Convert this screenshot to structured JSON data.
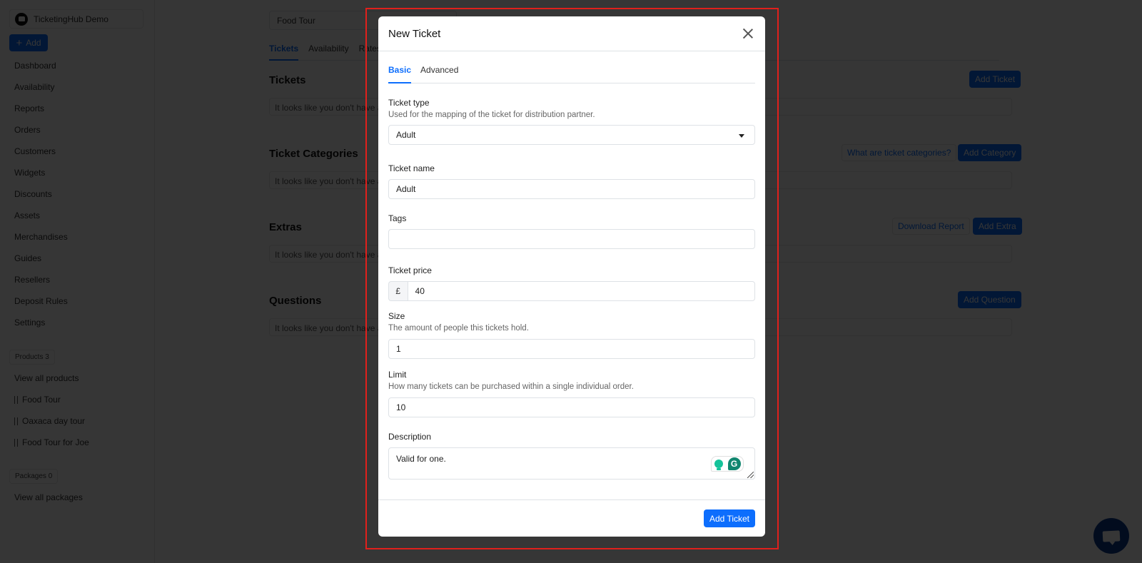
{
  "sidebar": {
    "org_name": "TicketingHub Demo",
    "add_label": "Add",
    "nav": [
      "Dashboard",
      "Availability",
      "Reports",
      "Orders",
      "Customers",
      "Widgets",
      "Discounts",
      "Assets",
      "Merchandises",
      "Guides",
      "Resellers",
      "Deposit Rules",
      "Settings"
    ],
    "products_badge": "Products 3",
    "view_all_products": "View all products",
    "products": [
      "Food Tour",
      "Oaxaca day tour",
      "Food Tour for Joe"
    ],
    "packages_badge": "Packages 0",
    "view_all_packages": "View all packages"
  },
  "main": {
    "product_select": "Food Tour",
    "tabs": [
      "Tickets",
      "Availability",
      "Rates"
    ],
    "active_tab": "Tickets",
    "sections": [
      {
        "title": "Tickets",
        "empty": "It looks like you don't have any tickets yet.",
        "buttons": [
          "Add Ticket"
        ]
      },
      {
        "title": "Ticket Categories",
        "empty": "It looks like you don't have any ticket categories yet.",
        "link": "What are ticket categories?",
        "buttons": [
          "Add Category"
        ]
      },
      {
        "title": "Extras",
        "empty": "It looks like you don't have any extras yet.",
        "outline": "Download Report",
        "buttons": [
          "Add Extra"
        ]
      },
      {
        "title": "Questions",
        "empty": "It looks like you don't have any questions yet.",
        "buttons": [
          "Add Question"
        ]
      }
    ]
  },
  "modal": {
    "title": "New Ticket",
    "tabs": [
      "Basic",
      "Advanced"
    ],
    "active_tab": "Basic",
    "ticket_type": {
      "label": "Ticket type",
      "help": "Used for the mapping of the ticket for distribution partner.",
      "value": "Adult"
    },
    "ticket_name": {
      "label": "Ticket name",
      "value": "Adult"
    },
    "tags": {
      "label": "Tags",
      "value": ""
    },
    "ticket_price": {
      "label": "Ticket price",
      "currency": "£",
      "value": "40"
    },
    "size": {
      "label": "Size",
      "help": "The amount of people this tickets hold.",
      "value": "1"
    },
    "limit": {
      "label": "Limit",
      "help": "How many tickets can be purchased within a single individual order.",
      "value": "10"
    },
    "description": {
      "label": "Description",
      "value": "Valid for one."
    },
    "submit_label": "Add Ticket"
  },
  "colors": {
    "primary": "#0d6efd",
    "highlight": "#e0201c",
    "chat": "#0d3b8f"
  }
}
